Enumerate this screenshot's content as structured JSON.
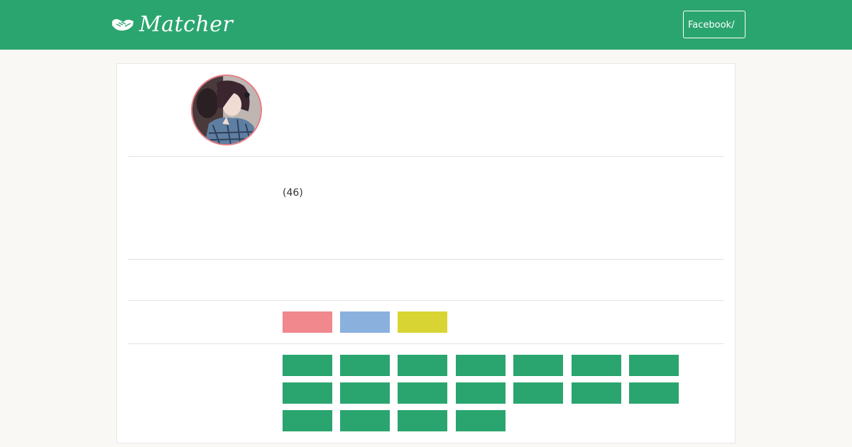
{
  "header": {
    "brand_name": "Matcher",
    "facebook_button_label": "Facebook/",
    "logo_icon": "handshake-icon"
  },
  "profile": {
    "avatar_alt": "profile-photo",
    "count_text": "(46)"
  },
  "colors": {
    "brand_green": "#2ba56f",
    "avatar_border": "#e57b82",
    "tag_pink": "#f0888d",
    "tag_blue": "#8ab0de",
    "tag_yellow": "#d8d434",
    "background": "#f9f8f4"
  },
  "tags": [
    {
      "color": "#f0888d"
    },
    {
      "color": "#8ab0de"
    },
    {
      "color": "#d8d434"
    }
  ],
  "grid_items_count": 18
}
